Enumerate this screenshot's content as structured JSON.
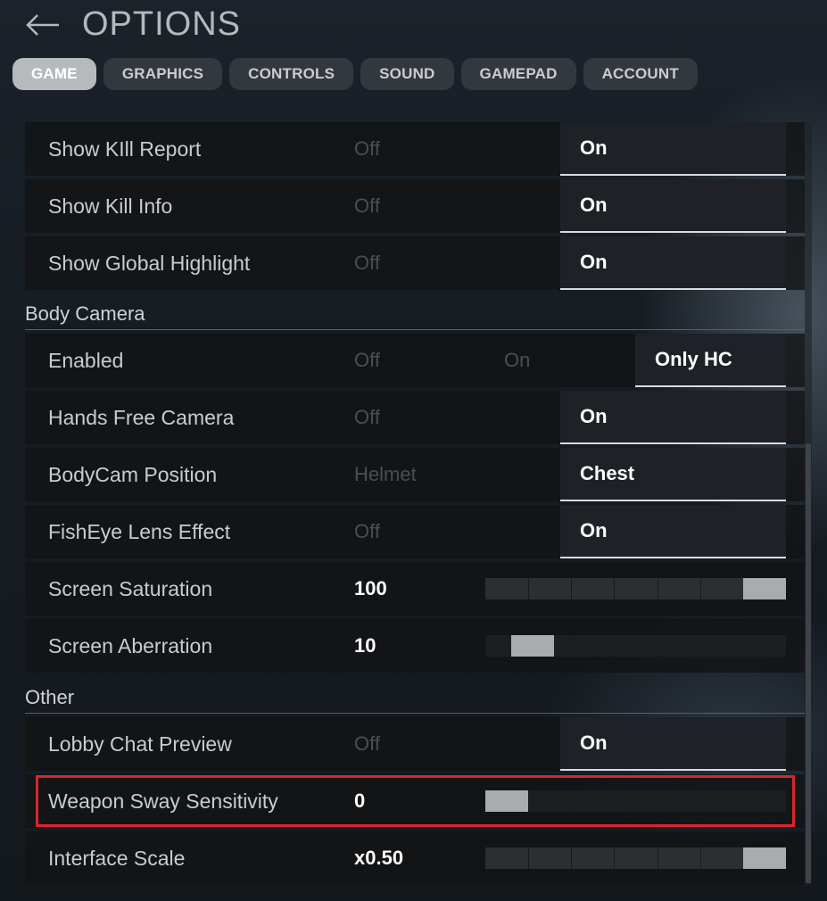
{
  "header": {
    "title": "OPTIONS",
    "back_icon": "arrow-left-icon"
  },
  "tabs": [
    {
      "label": "GAME",
      "active": true
    },
    {
      "label": "GRAPHICS",
      "active": false
    },
    {
      "label": "CONTROLS",
      "active": false
    },
    {
      "label": "SOUND",
      "active": false
    },
    {
      "label": "GAMEPAD",
      "active": false
    },
    {
      "label": "ACCOUNT",
      "active": false
    }
  ],
  "settings": {
    "show_kill_report": {
      "label": "Show KIll Report",
      "off": "Off",
      "selected": "On"
    },
    "show_kill_info": {
      "label": "Show Kill Info",
      "off": "Off",
      "selected": "On"
    },
    "show_global_highlight": {
      "label": "Show Global Highlight",
      "off": "Off",
      "selected": "On"
    },
    "body_camera_section": "Body Camera",
    "enabled": {
      "label": "Enabled",
      "off": "Off",
      "mid": "On",
      "selected": "Only HC"
    },
    "hands_free_camera": {
      "label": "Hands Free Camera",
      "off": "Off",
      "selected": "On"
    },
    "bodycam_position": {
      "label": "BodyCam Position",
      "off": "Helmet",
      "selected": "Chest"
    },
    "fisheye_lens_effect": {
      "label": "FishEye Lens Effect",
      "off": "Off",
      "selected": "On"
    },
    "screen_saturation": {
      "label": "Screen Saturation",
      "value": "100",
      "level": 1.0
    },
    "screen_aberration": {
      "label": "Screen Aberration",
      "value": "10",
      "level": 0.1
    },
    "other_section": "Other",
    "lobby_chat_preview": {
      "label": "Lobby Chat Preview",
      "off": "Off",
      "selected": "On"
    },
    "weapon_sway_sensitivity": {
      "label": "Weapon Sway Sensitivity",
      "value": "0",
      "level": 0.0
    },
    "interface_scale": {
      "label": "Interface Scale",
      "value": "x0.50",
      "level": 1.0
    }
  },
  "colors": {
    "highlight_box": "#d9262c",
    "active_tab": "#b7babd"
  }
}
